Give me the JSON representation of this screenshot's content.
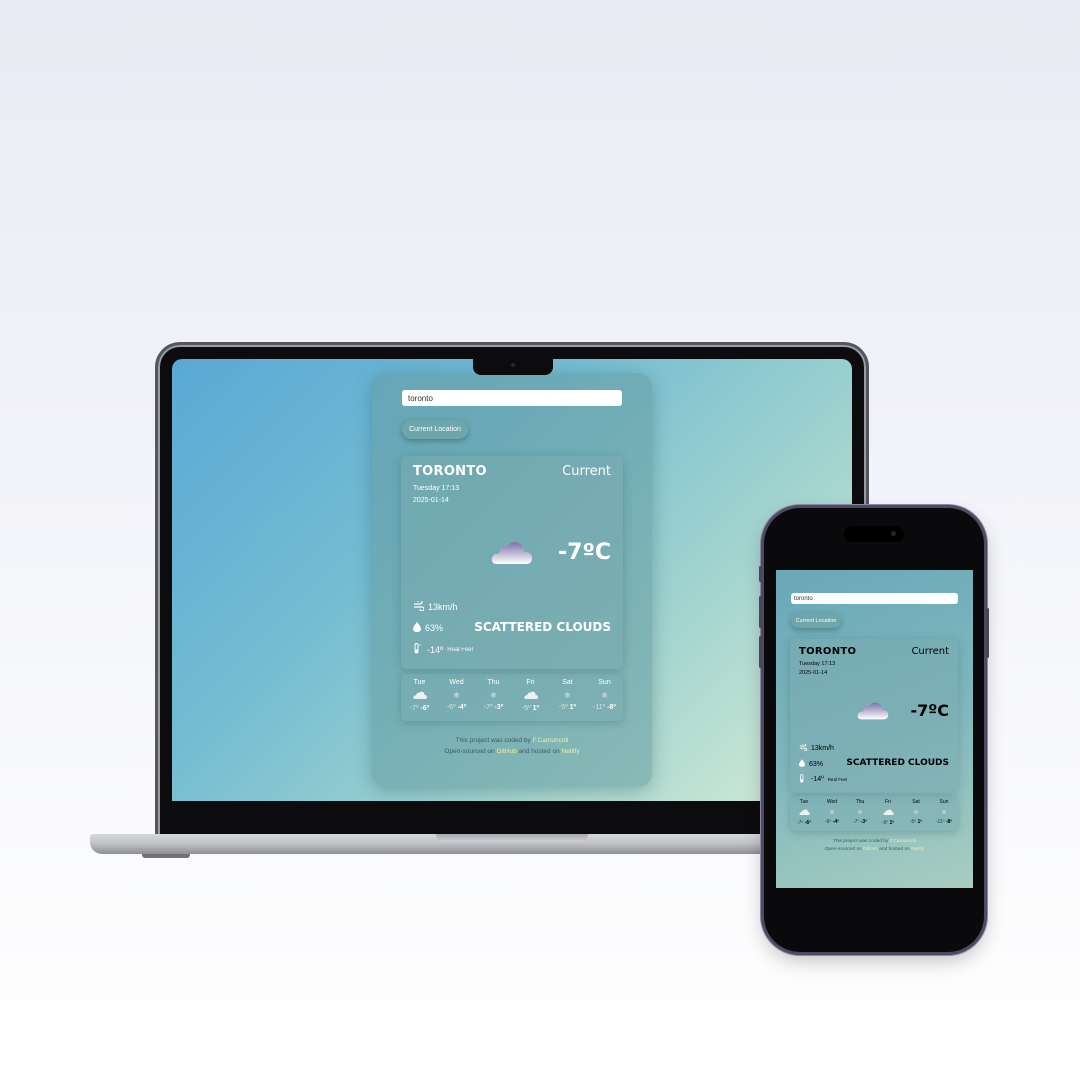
{
  "search": {
    "value": "toronto"
  },
  "location_button": "Current Location",
  "current": {
    "city": "TORONTO",
    "label": "Current",
    "day_time": "Tuesday 17:13",
    "date": "2025-01-14",
    "temperature": "-7ºC",
    "condition": "SCATTERED CLOUDS",
    "wind": "13km/h",
    "humidity": "63%",
    "real_feel": "-14º",
    "real_feel_label": "Real Feel"
  },
  "forecast": [
    {
      "day": "Tue",
      "icon": "cloud-icon",
      "low": "-7º",
      "high": "-6º"
    },
    {
      "day": "Wed",
      "icon": "snow-icon",
      "low": "-6º",
      "high": "-4º"
    },
    {
      "day": "Thu",
      "icon": "snow-icon",
      "low": "-7º",
      "high": "-3º"
    },
    {
      "day": "Fri",
      "icon": "cloud-icon",
      "low": "-5º",
      "high": "1º"
    },
    {
      "day": "Sat",
      "icon": "snow-icon",
      "low": "-5º",
      "high": "1º"
    },
    {
      "day": "Sun",
      "icon": "snow-icon",
      "low": "-11º",
      "high": "-8º"
    }
  ],
  "footer": {
    "line1_prefix": "This project was coded by",
    "author": "F.Camuncoli",
    "line2_prefix": "Open-sourced on",
    "github": "GitHub",
    "line2_mid": "and hosted on",
    "netlify": "Netlify"
  },
  "colors": {
    "background_top": "#e9ebf4",
    "screen_gradient_start": "#5aa9d6",
    "screen_gradient_end": "#d6ecd6",
    "link": "#f6eba0"
  }
}
